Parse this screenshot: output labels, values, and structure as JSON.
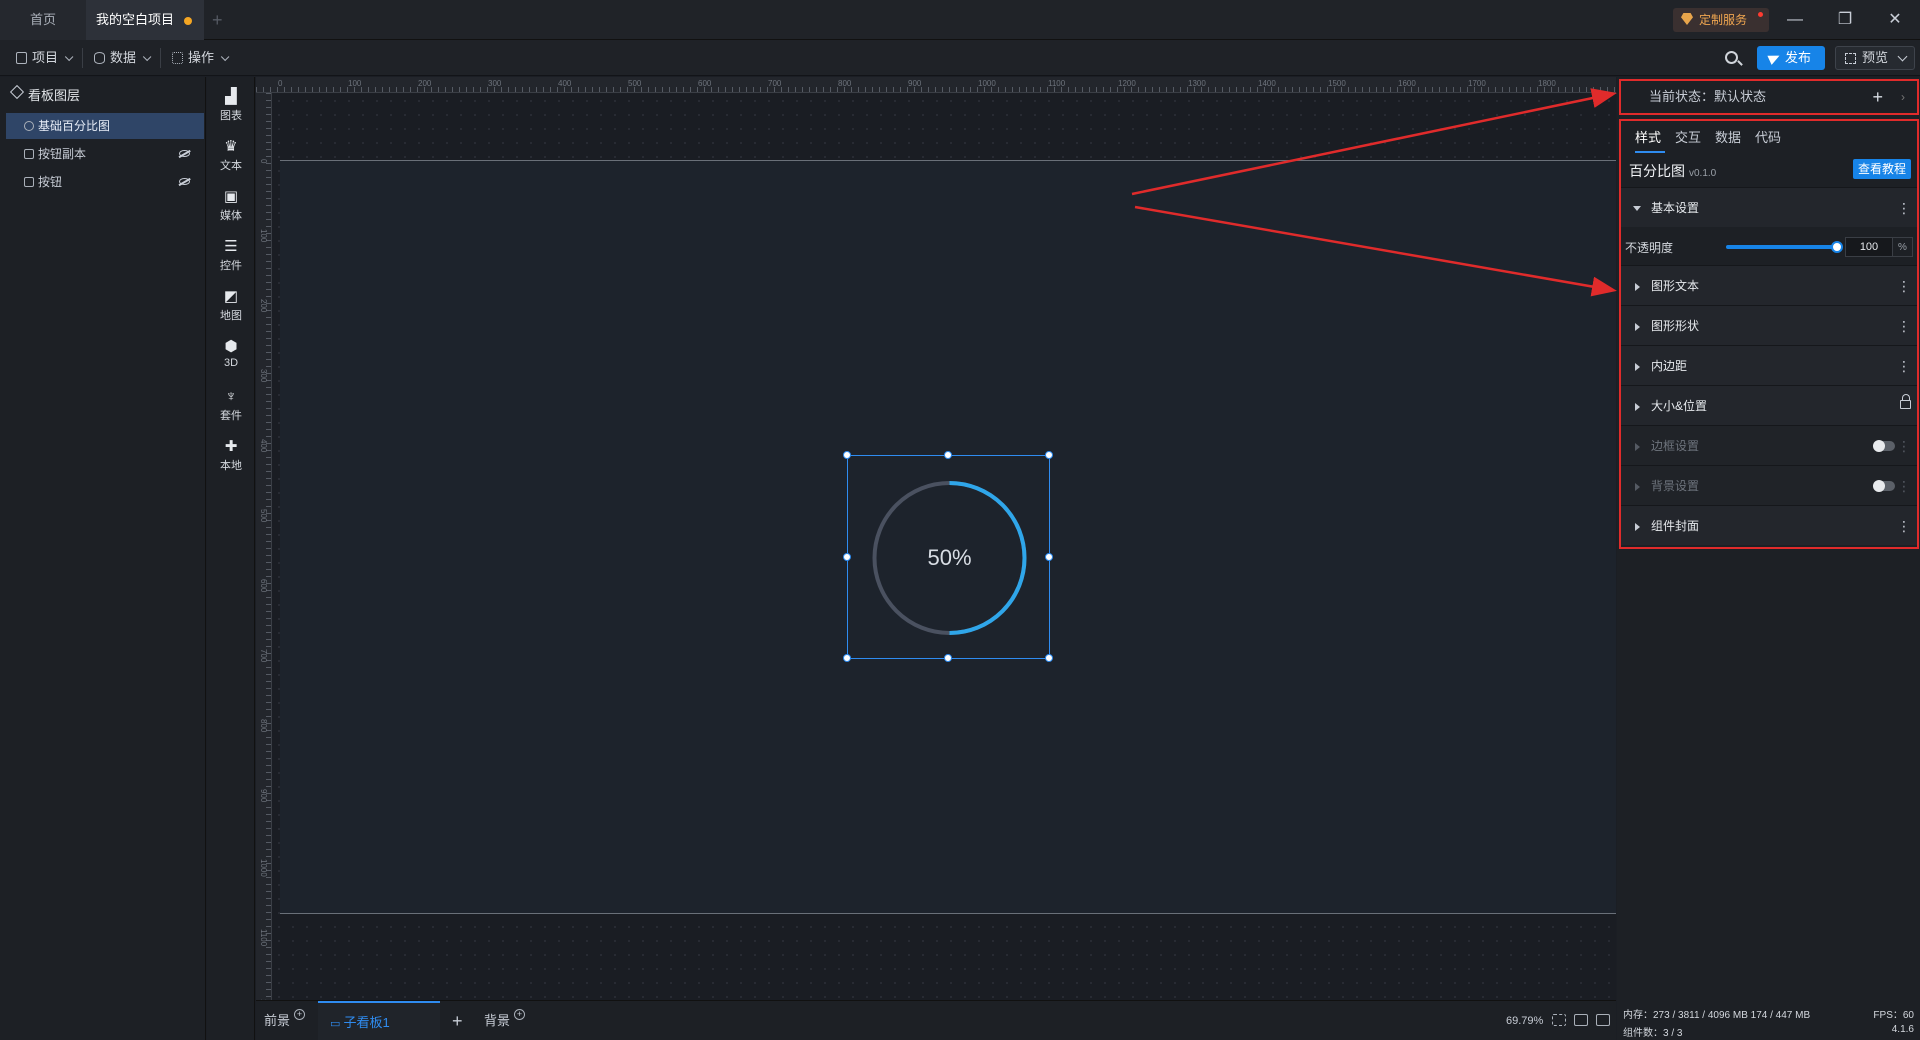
{
  "tabs": {
    "home": "首页",
    "active": "我的空白项目",
    "add": "+"
  },
  "window": {
    "custom_service": "定制服务",
    "minimize": "—",
    "restore": "❐",
    "close": "✕"
  },
  "toolbar": {
    "project": "项目",
    "data": "数据",
    "operate": "操作",
    "publish": "发布",
    "preview": "预览"
  },
  "layers": {
    "title": "看板图层",
    "items": [
      {
        "label": "基础百分比图",
        "selected": true,
        "hidden": false
      },
      {
        "label": "按钮副本",
        "selected": false,
        "hidden": true
      },
      {
        "label": "按钮",
        "selected": false,
        "hidden": true
      }
    ]
  },
  "components": [
    {
      "label": "图表",
      "icon": "chart-icon",
      "glyph": "▟"
    },
    {
      "label": "文本",
      "icon": "text-icon",
      "glyph": "♛"
    },
    {
      "label": "媒体",
      "icon": "media-icon",
      "glyph": "▣"
    },
    {
      "label": "控件",
      "icon": "control-icon",
      "glyph": "☰"
    },
    {
      "label": "地图",
      "icon": "map-icon",
      "glyph": "◩"
    },
    {
      "label": "3D",
      "icon": "cube-icon",
      "glyph": "⬢"
    },
    {
      "label": "套件",
      "icon": "suite-icon",
      "glyph": "♆"
    },
    {
      "label": "本地",
      "icon": "puzzle-icon",
      "glyph": "✚"
    }
  ],
  "ruler": {
    "top_ticks": [
      "0",
      "100",
      "200",
      "300",
      "400",
      "500",
      "600",
      "700",
      "800",
      "900",
      "1000",
      "1100",
      "1200",
      "1300",
      "1400",
      "1500",
      "1600",
      "1700",
      "1800"
    ],
    "left_ticks": [
      "0",
      "100",
      "200",
      "300",
      "400",
      "500",
      "600",
      "700",
      "800",
      "900",
      "1000",
      "1100",
      "1200"
    ]
  },
  "widget": {
    "percent_text": "50%",
    "value": 0.5,
    "track_color": "#4a5160",
    "progress_color": "#2fa6ea"
  },
  "bottom": {
    "front": "前景",
    "subboard": "子看板1",
    "back": "背景",
    "add": "+",
    "zoom": "69.79%"
  },
  "panel": {
    "state_label": "当前状态：默认状态",
    "tabs": [
      "样式",
      "交互",
      "数据",
      "代码"
    ],
    "component_name": "百分比图",
    "component_version": "v0.1.0",
    "tutorial_button": "查看教程",
    "sections": [
      {
        "label": "基本设置",
        "open": true,
        "control": "more"
      },
      {
        "label": "图形文本",
        "open": false,
        "control": "more"
      },
      {
        "label": "图形形状",
        "open": false,
        "control": "more"
      },
      {
        "label": "内边距",
        "open": false,
        "control": "more"
      },
      {
        "label": "大小&位置",
        "open": false,
        "control": "lock"
      },
      {
        "label": "边框设置",
        "open": false,
        "control": "toggle",
        "disabled": true
      },
      {
        "label": "背景设置",
        "open": false,
        "control": "toggle",
        "disabled": true
      },
      {
        "label": "组件封面",
        "open": false,
        "control": "more"
      }
    ],
    "opacity_label": "不透明度",
    "opacity_value": "100",
    "opacity_unit": "%"
  },
  "status": {
    "memory": "内存：273 / 3811 / 4096 MB  174 / 447 MB",
    "fps": "FPS：60",
    "components": "组件数：3 / 3",
    "version": "4.1.6"
  },
  "annotation_color": "#e02b2b"
}
